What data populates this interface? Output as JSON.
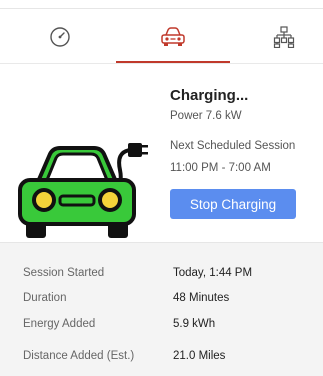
{
  "tabs": [
    {
      "icon": "gauge-icon",
      "label": ""
    },
    {
      "icon": "car-icon",
      "label": ""
    },
    {
      "icon": "network-icon",
      "label": ""
    }
  ],
  "active_tab_color": "#c0392b",
  "status": {
    "title": "Charging...",
    "power": "Power 7.6 kW",
    "next_label": "Next Scheduled Session",
    "next_time": "11:00 PM - 7:00 AM",
    "stop_label": "Stop Charging",
    "button_color": "#5b8def",
    "car_color": "#39c93a"
  },
  "details": {
    "session_started_label": "Session Started",
    "session_started_value": "Today, 1:44 PM",
    "duration_label": "Duration",
    "duration_value": "48 Minutes",
    "energy_label": "Energy Added",
    "energy_value": "5.9 kWh",
    "distance_label": "Distance Added (Est.)",
    "distance_value": "21.0 Miles"
  }
}
